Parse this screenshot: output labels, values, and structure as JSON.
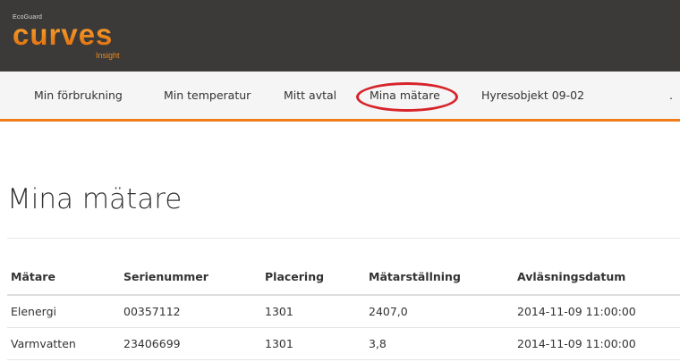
{
  "brand": {
    "company": "EcoGuard",
    "product": "curves",
    "tagline": "Insight"
  },
  "nav": {
    "items": [
      {
        "label": "Min förbrukning"
      },
      {
        "label": "Min temperatur"
      },
      {
        "label": "Mitt avtal"
      },
      {
        "label": "Mina mätare",
        "active": true
      },
      {
        "label": "Hyresobjekt 09-02"
      },
      {
        "label": "."
      }
    ],
    "accent_color": "#f07d1a",
    "highlight_color": "#d6242a"
  },
  "page": {
    "title": "Mina mätare"
  },
  "table": {
    "columns": [
      "Mätare",
      "Serienummer",
      "Placering",
      "Mätarställning",
      "Avläsningsdatum"
    ],
    "rows": [
      [
        "Elenergi",
        "00357112",
        "1301",
        "2407,0",
        "2014-11-09 11:00:00"
      ],
      [
        "Varmvatten",
        "23406699",
        "1301",
        "3,8",
        "2014-11-09 11:00:00"
      ]
    ]
  }
}
